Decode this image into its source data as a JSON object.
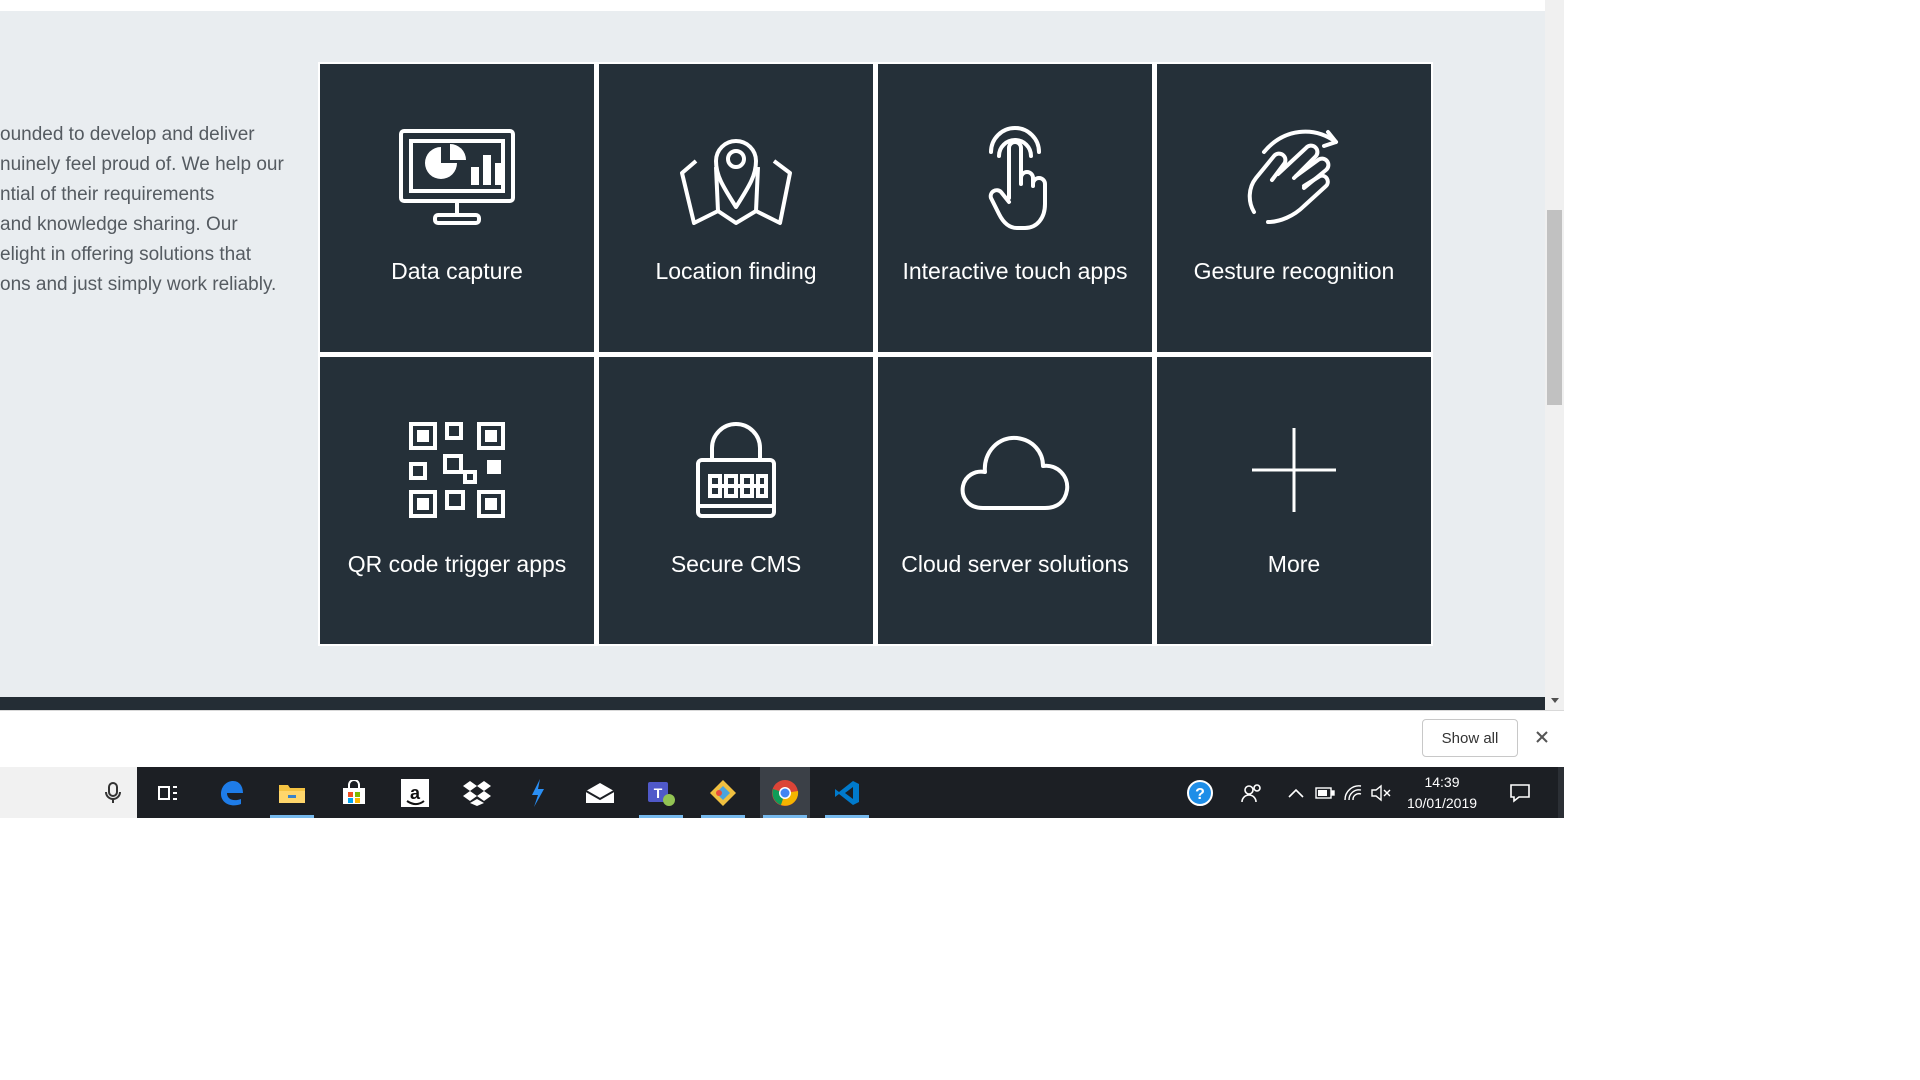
{
  "intro": {
    "lines": [
      "ounded to develop and deliver",
      "nuinely feel proud of. We help our",
      "ntial of their requirements",
      "and knowledge sharing. Our",
      "elight in offering solutions that",
      "ons and just simply work reliably."
    ]
  },
  "tiles": [
    {
      "label": "Data capture",
      "icon": "monitor-chart-icon"
    },
    {
      "label": "Location finding",
      "icon": "map-pin-icon"
    },
    {
      "label": "Interactive touch apps",
      "icon": "touch-hand-icon"
    },
    {
      "label": "Gesture recognition",
      "icon": "gesture-hand-icon"
    },
    {
      "label": "QR code trigger apps",
      "icon": "qr-code-icon"
    },
    {
      "label": "Secure CMS",
      "icon": "padlock-icon"
    },
    {
      "label": "Cloud server solutions",
      "icon": "cloud-icon"
    },
    {
      "label": "More",
      "icon": "plus-icon"
    }
  ],
  "download_bar": {
    "show_all_label": "Show all"
  },
  "taskbar": {
    "apps": [
      "microphone-icon",
      "task-view-icon",
      "edge-icon",
      "file-explorer-icon",
      "store-icon",
      "amazon-icon",
      "dropbox-icon",
      "visual-studio-icon",
      "mail-icon",
      "teams-icon",
      "git-icon",
      "chrome-icon",
      "vscode-icon"
    ],
    "time": "14:39",
    "date": "10/01/2019"
  },
  "colors": {
    "tile_bg": "#253039",
    "page_bg": "#e9edf0",
    "taskbar_bg": "#1c1f24",
    "accent": "#76b9ed"
  }
}
